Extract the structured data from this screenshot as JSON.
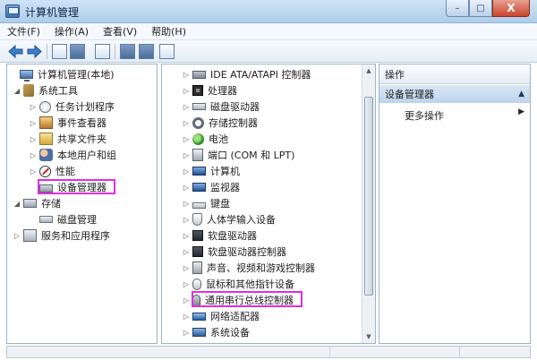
{
  "window": {
    "title": "计算机管理"
  },
  "caption": {
    "minimize": "–",
    "maximize": "□",
    "close": "X"
  },
  "menu": [
    {
      "label": "文件(F)"
    },
    {
      "label": "操作(A)"
    },
    {
      "label": "查看(V)"
    },
    {
      "label": "帮助(H)"
    }
  ],
  "left_tree": [
    {
      "label": "计算机管理(本地)",
      "expander": "",
      "icon": "computer"
    },
    {
      "label": "系统工具",
      "expander": "◢",
      "icon": "tools"
    },
    {
      "label": "任务计划程序",
      "expander": "▷",
      "icon": "clock"
    },
    {
      "label": "事件查看器",
      "expander": "▷",
      "icon": "event"
    },
    {
      "label": "共享文件夹",
      "expander": "▷",
      "icon": "share"
    },
    {
      "label": "本地用户和组",
      "expander": "▷",
      "icon": "users"
    },
    {
      "label": "性能",
      "expander": "▷",
      "icon": "perf"
    },
    {
      "label": "设备管理器",
      "expander": "",
      "icon": "devmgr"
    },
    {
      "label": "存储",
      "expander": "◢",
      "icon": "storage"
    },
    {
      "label": "磁盘管理",
      "expander": "",
      "icon": "disk"
    },
    {
      "label": "服务和应用程序",
      "expander": "▷",
      "icon": "services"
    }
  ],
  "device_tree": [
    {
      "label": "IDE ATA/ATAPI 控制器",
      "icon": "ide"
    },
    {
      "label": "处理器",
      "icon": "cpu"
    },
    {
      "label": "磁盘驱动器",
      "icon": "drive"
    },
    {
      "label": "存储控制器",
      "icon": "gear"
    },
    {
      "label": "电池",
      "icon": "battery"
    },
    {
      "label": "端口 (COM 和 LPT)",
      "icon": "port"
    },
    {
      "label": "计算机",
      "icon": "monitor"
    },
    {
      "label": "监视器",
      "icon": "monitor"
    },
    {
      "label": "键盘",
      "icon": "keyboard"
    },
    {
      "label": "人体学输入设备",
      "icon": "hid"
    },
    {
      "label": "软盘驱动器",
      "icon": "floppy"
    },
    {
      "label": "软盘驱动器控制器",
      "icon": "floppy"
    },
    {
      "label": "声音、视频和游戏控制器",
      "icon": "sound"
    },
    {
      "label": "鼠标和其他指针设备",
      "icon": "mouse"
    },
    {
      "label": "通用串行总线控制器",
      "icon": "usb"
    },
    {
      "label": "网络适配器",
      "icon": "net"
    },
    {
      "label": "系统设备",
      "icon": "system"
    }
  ],
  "actions": {
    "header": "操作",
    "section": "设备管理器",
    "more": "更多操作"
  },
  "colors": {
    "highlight": "#e02fe0",
    "title_bar": "#aecde9",
    "action_section": "#bdd3ea"
  }
}
